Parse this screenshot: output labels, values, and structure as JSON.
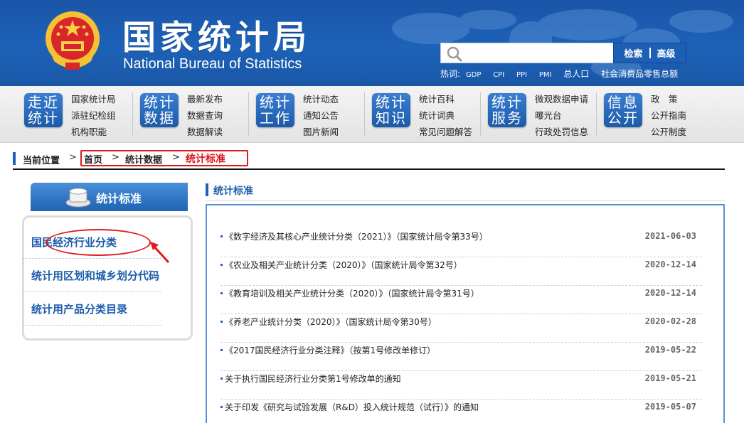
{
  "header": {
    "title_cn": "国家统计局",
    "title_en": "National Bureau of Statistics",
    "search": {
      "placeholder": "",
      "search_label": "检索",
      "advanced_label": "高级"
    },
    "hotwords_label": "热词:",
    "hotwords": [
      "GDP",
      "CPI",
      "PPI",
      "PMI",
      "总人口",
      "社会消费品零售总额"
    ]
  },
  "nav": [
    {
      "badge": [
        "走近",
        "统计"
      ],
      "links": [
        "国家统计局",
        "派驻纪检组",
        "机构职能"
      ]
    },
    {
      "badge": [
        "统计",
        "数据"
      ],
      "links": [
        "最新发布",
        "数据查询",
        "数据解读"
      ]
    },
    {
      "badge": [
        "统计",
        "工作"
      ],
      "links": [
        "统计动态",
        "通知公告",
        "图片新闻"
      ]
    },
    {
      "badge": [
        "统计",
        "知识"
      ],
      "links": [
        "统计百科",
        "统计词典",
        "常见问题解答"
      ]
    },
    {
      "badge": [
        "统计",
        "服务"
      ],
      "links": [
        "微观数据申请",
        "曝光台",
        "行政处罚信息"
      ]
    },
    {
      "badge": [
        "信息",
        "公开"
      ],
      "links": [
        "政　策",
        "公开指南",
        "公开制度"
      ]
    }
  ],
  "breadcrumb": {
    "label": "当前位置",
    "items": [
      "首页",
      "统计数据",
      "统计标准"
    ],
    "separator": ">"
  },
  "sidebar": {
    "title": "统计标准",
    "items": [
      "国民经济行业分类",
      "统计用区划和城乡划分代码",
      "统计用产品分类目录"
    ]
  },
  "main": {
    "title": "统计标准",
    "items": [
      {
        "title": "《数字经济及其核心产业统计分类（2021）》（国家统计局令第33号）",
        "date": "2021-06-03"
      },
      {
        "title": "《农业及相关产业统计分类（2020）》（国家统计局令第32号）",
        "date": "2020-12-14"
      },
      {
        "title": "《教育培训及相关产业统计分类（2020）》（国家统计局令第31号）",
        "date": "2020-12-14"
      },
      {
        "title": "《养老产业统计分类（2020）》（国家统计局令第30号）",
        "date": "2020-02-28"
      },
      {
        "title": "《2017国民经济行业分类注释》（按第1号修改单修订）",
        "date": "2019-05-22"
      },
      {
        "title": "关于执行国民经济行业分类第1号修改单的通知",
        "date": "2019-05-21"
      },
      {
        "title": "关于印发《研究与试验发展（R&D）投入统计规范（试行）》的通知",
        "date": "2019-05-07"
      }
    ]
  },
  "colors": {
    "brand_blue": "#1d62b8",
    "highlight_red": "#e0191b",
    "link_blue": "#1d5cab"
  }
}
